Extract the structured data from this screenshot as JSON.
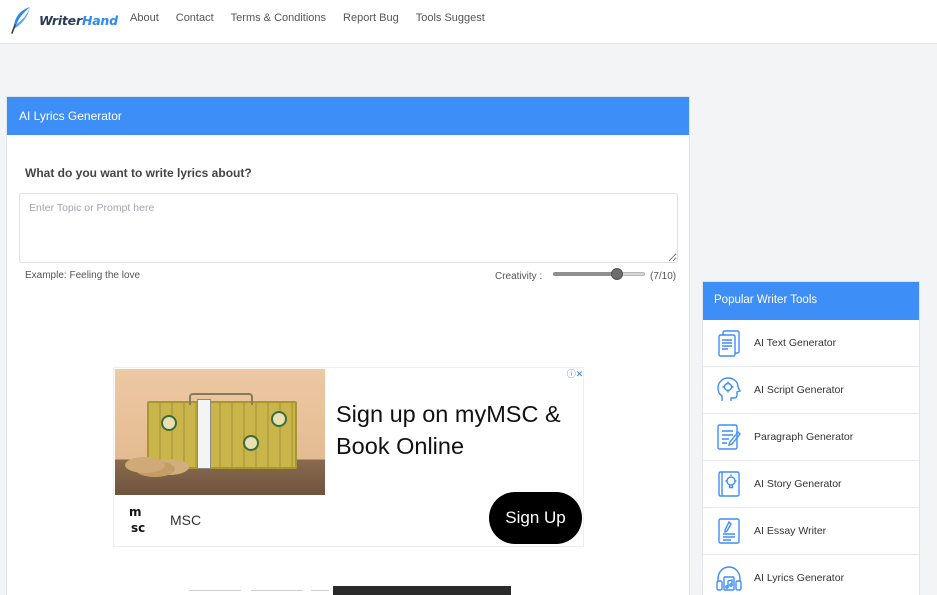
{
  "header": {
    "logo": {
      "part1": "Writer",
      "part2": "Hand",
      "icon": "feather-quill-icon"
    },
    "nav": [
      "About",
      "Contact",
      "Terms & Conditions",
      "Report Bug",
      "Tools Suggest"
    ]
  },
  "generator": {
    "title": "AI Lyrics Generator",
    "question": "What do you want to write lyrics about?",
    "input": {
      "value": "",
      "placeholder": "Enter Topic or Prompt here"
    },
    "example": "Example: Feeling the love",
    "creativity": {
      "label": "Creativity :",
      "value": 7,
      "max": 10,
      "display": "(7/10)"
    }
  },
  "ad": {
    "headline": "Sign up on myMSC & Book Online",
    "brand": "MSC",
    "cta": "Sign Up",
    "choices_icon": "ad-choices-icon"
  },
  "sidebar": {
    "title": "Popular Writer Tools",
    "tools": [
      {
        "label": "AI Text Generator",
        "icon": "text-document-icon"
      },
      {
        "label": "AI Script Generator",
        "icon": "head-gear-icon"
      },
      {
        "label": "Paragraph Generator",
        "icon": "edit-document-icon"
      },
      {
        "label": "AI Story Generator",
        "icon": "book-lightbulb-icon"
      },
      {
        "label": "AI Essay Writer",
        "icon": "essay-pencil-icon"
      },
      {
        "label": "AI Lyrics Generator",
        "icon": "headphones-music-icon"
      }
    ]
  },
  "colors": {
    "accent": "#3e8ef7",
    "logo_dark": "#2b3a55",
    "logo_blue": "#2f89f0"
  }
}
